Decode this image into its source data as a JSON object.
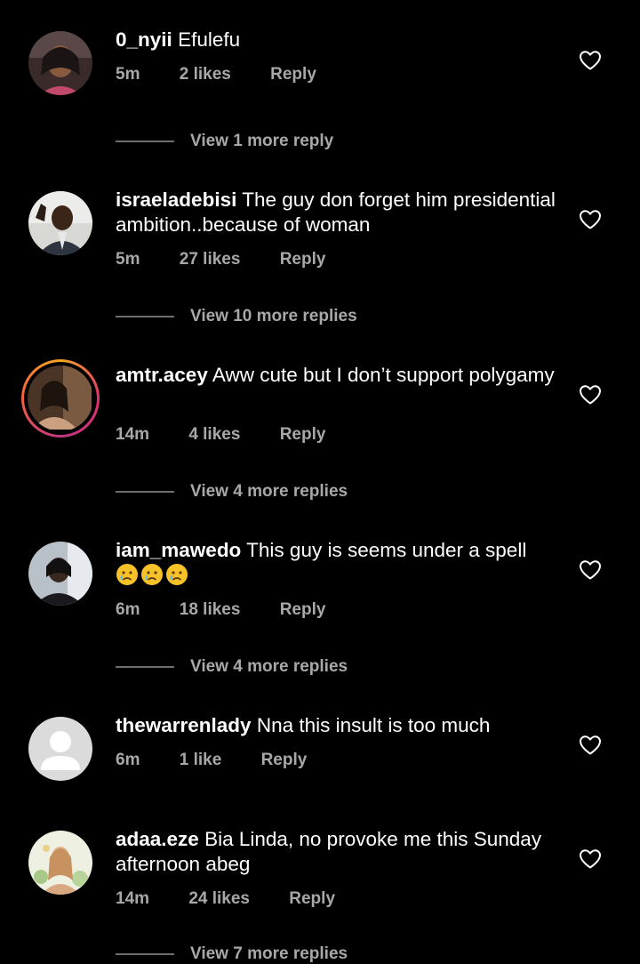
{
  "comments": [
    {
      "username": "0_nyii",
      "text": "Efulefu",
      "time": "5m",
      "likes": "2 likes",
      "reply": "Reply",
      "view_replies": "View 1 more reply",
      "avatar": "woman-portrait"
    },
    {
      "username": "israeladebisi",
      "text": "The guy don forget him presidential ambition..because of woman",
      "time": "5m",
      "likes": "27 likes",
      "reply": "Reply",
      "view_replies": "View 10 more replies",
      "avatar": "man-portrait"
    },
    {
      "username": "amtr.acey",
      "text": "Aww cute but I don’t support polygamy",
      "time": "14m",
      "likes": "4 likes",
      "reply": "Reply",
      "view_replies": "View 4 more replies",
      "avatar": "selfie-portrait",
      "story_ring": true
    },
    {
      "username": "iam_mawedo",
      "text": "This guy is seems under a spell",
      "emojis": [
        "crying-face-emoji",
        "crying-face-emoji",
        "crying-face-emoji"
      ],
      "time": "6m",
      "likes": "18 likes",
      "reply": "Reply",
      "view_replies": "View 4 more replies",
      "avatar": "car-selfie-portrait"
    },
    {
      "username": "thewarrenlady",
      "text": "Nna this insult is too much",
      "time": "6m",
      "likes": "1 like",
      "reply": "Reply",
      "avatar": "default-avatar"
    },
    {
      "username": "adaa.eze",
      "text": "Bia Linda, no provoke me this Sunday afternoon abeg",
      "time": "14m",
      "likes": "24 likes",
      "reply": "Reply",
      "view_replies": "View 7 more replies",
      "avatar": "illustration-portrait"
    }
  ],
  "icons": {
    "like": "heart-outline-icon"
  },
  "colors": {
    "background": "#000000",
    "primary_text": "#ffffff",
    "secondary_text": "#a8a8a8"
  }
}
